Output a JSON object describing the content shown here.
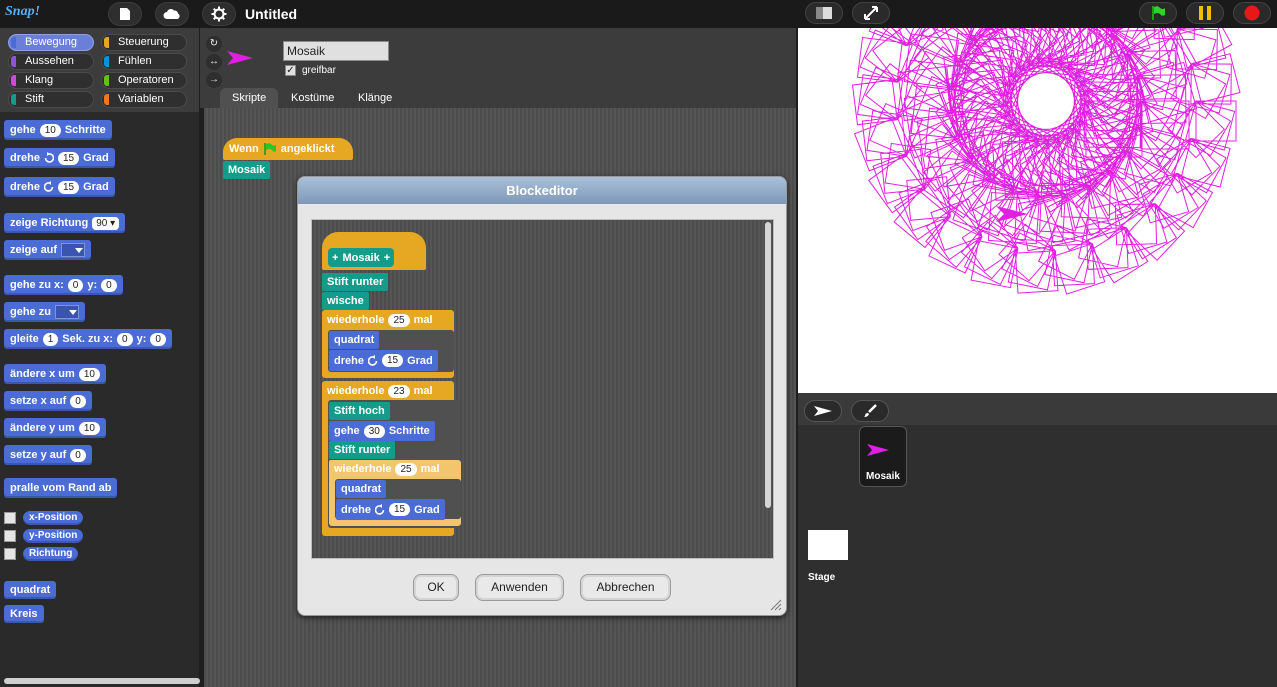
{
  "app": {
    "logo_text": "Snap!",
    "project_title": "Untitled",
    "icons": {
      "new": "page-icon",
      "cloud": "cloud-icon",
      "settings": "gear-icon",
      "layout": "layout-toggle-icon",
      "fullscreen": "expand-icon",
      "green_flag": "green-flag-icon",
      "pause": "pause-icon",
      "stop": "stop-icon"
    }
  },
  "categories": [
    {
      "label": "Bewegung",
      "color": "#4a6cd4",
      "selected": true
    },
    {
      "label": "Steuerung",
      "color": "#e6a822",
      "selected": false
    },
    {
      "label": "Aussehen",
      "color": "#8a55d7",
      "selected": false
    },
    {
      "label": "Fühlen",
      "color": "#0494dc",
      "selected": false
    },
    {
      "label": "Klang",
      "color": "#cf4ad9",
      "selected": false
    },
    {
      "label": "Operatoren",
      "color": "#62c213",
      "selected": false
    },
    {
      "label": "Stift",
      "color": "#149b8a",
      "selected": false
    },
    {
      "label": "Variablen",
      "color": "#f3761d",
      "selected": false
    }
  ],
  "palette": {
    "move": {
      "label": "gehe",
      "value": "10",
      "suffix": "Schritte"
    },
    "turn_cw": {
      "label": "drehe",
      "value": "15",
      "suffix": "Grad"
    },
    "turn_ccw": {
      "label": "drehe",
      "value": "15",
      "suffix": "Grad"
    },
    "point_dir": {
      "label": "zeige Richtung",
      "value": "90"
    },
    "point_to": {
      "label": "zeige auf"
    },
    "goto_xy": {
      "label": "gehe zu x:",
      "x": "0",
      "ylabel": "y:",
      "y": "0"
    },
    "goto": {
      "label": "gehe zu"
    },
    "glide": {
      "label": "gleite",
      "secs": "1",
      "mid": "Sek. zu x:",
      "x": "0",
      "ylabel": "y:",
      "y": "0"
    },
    "change_x": {
      "label": "ändere x um",
      "value": "10"
    },
    "set_x": {
      "label": "setze x auf",
      "value": "0"
    },
    "change_y": {
      "label": "ändere y um",
      "value": "10"
    },
    "set_y": {
      "label": "setze y auf",
      "value": "0"
    },
    "bounce": {
      "label": "pralle vom Rand ab"
    },
    "rep_x": "x-Position",
    "rep_y": "y-Position",
    "rep_dir": "Richtung",
    "custom1": "quadrat",
    "custom2": "Kreis"
  },
  "sprite": {
    "name": "Mosaik",
    "draggable_label": "greifbar",
    "draggable_checked": "✓",
    "rotation_icons": [
      "rotate-icon",
      "flip-icon",
      "no-rotate-icon"
    ]
  },
  "tabs": [
    {
      "label": "Skripte",
      "active": true
    },
    {
      "label": "Kostüme",
      "active": false
    },
    {
      "label": "Klänge",
      "active": false
    }
  ],
  "script_area": {
    "hat_label_1": "Wenn",
    "hat_label_2": "angeklickt",
    "call_block": "Mosaik"
  },
  "block_editor": {
    "title": "Blockeditor",
    "proto_name": "Mosaik",
    "proto_plus": "+",
    "pen_down": "Stift runter",
    "clear": "wische",
    "repeat1": {
      "label": "wiederhole",
      "value": "25",
      "suffix": "mal"
    },
    "square1": "quadrat",
    "turn1": {
      "label": "drehe",
      "value": "15",
      "suffix": "Grad"
    },
    "repeat2": {
      "label": "wiederhole",
      "value": "23",
      "suffix": "mal"
    },
    "pen_up": "Stift hoch",
    "move2": {
      "label": "gehe",
      "value": "30",
      "suffix": "Schritte"
    },
    "pen_down2": "Stift runter",
    "repeat3": {
      "label": "wiederhole",
      "value": "25",
      "suffix": "mal"
    },
    "square2": "quadrat",
    "turn2": {
      "label": "drehe",
      "value": "15",
      "suffix": "Grad"
    },
    "ok": "OK",
    "apply": "Anwenden",
    "cancel": "Abbrechen"
  },
  "corral": {
    "sprite_label": "Mosaik",
    "stage_label": "Stage",
    "icons": [
      "turtle-arrow-icon",
      "paintbrush-icon"
    ]
  },
  "colors": {
    "pen": "#e020e0",
    "motion": "#4a6cd4",
    "control": "#e6a822",
    "pen_block": "#149b8a"
  }
}
